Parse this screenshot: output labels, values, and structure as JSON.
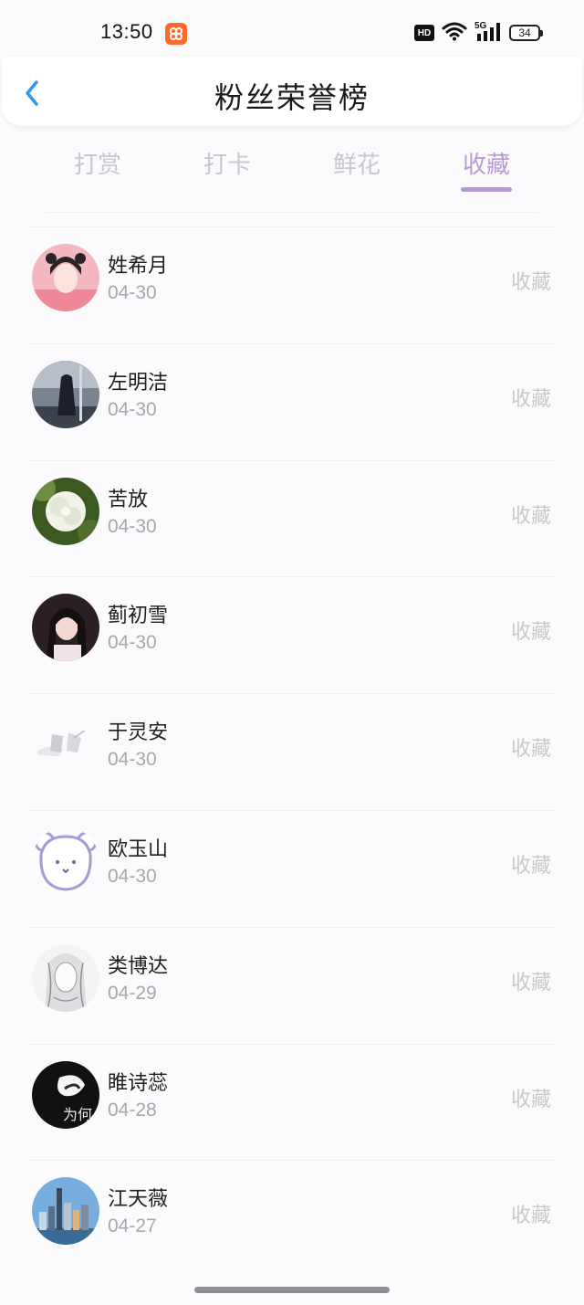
{
  "status_bar": {
    "time": "13:50",
    "hd_label": "HD",
    "battery": "34",
    "network": "5G"
  },
  "header": {
    "title": "粉丝荣誉榜"
  },
  "tabs": [
    {
      "label": "打赏"
    },
    {
      "label": "打卡"
    },
    {
      "label": "鲜花"
    },
    {
      "label": "收藏"
    }
  ],
  "active_tab": "收藏",
  "colors": {
    "accent": "#b69ad2",
    "back_arrow": "#2a9be8",
    "muted": "#c8c8cc"
  },
  "fans": [
    {
      "name": "姓希月",
      "date": "04-30",
      "action": "收藏",
      "avatar": "portrait-girl-pink"
    },
    {
      "name": "左明洁",
      "date": "04-30",
      "action": "收藏",
      "avatar": "dark-figure"
    },
    {
      "name": "苦放",
      "date": "04-30",
      "action": "收藏",
      "avatar": "white-flower"
    },
    {
      "name": "蓟初雪",
      "date": "04-30",
      "action": "收藏",
      "avatar": "portrait-woman"
    },
    {
      "name": "于灵安",
      "date": "04-30",
      "action": "收藏",
      "avatar": "faded-sketch"
    },
    {
      "name": "欧玉山",
      "date": "04-30",
      "action": "收藏",
      "avatar": "bear-outline"
    },
    {
      "name": "类博达",
      "date": "04-29",
      "action": "收藏",
      "avatar": "anime-sketch"
    },
    {
      "name": "睢诗蕊",
      "date": "04-28",
      "action": "收藏",
      "avatar": "dark-hand",
      "avatar_text": "为何"
    },
    {
      "name": "江天薇",
      "date": "04-27",
      "action": "收藏",
      "avatar": "city-skyline"
    }
  ]
}
